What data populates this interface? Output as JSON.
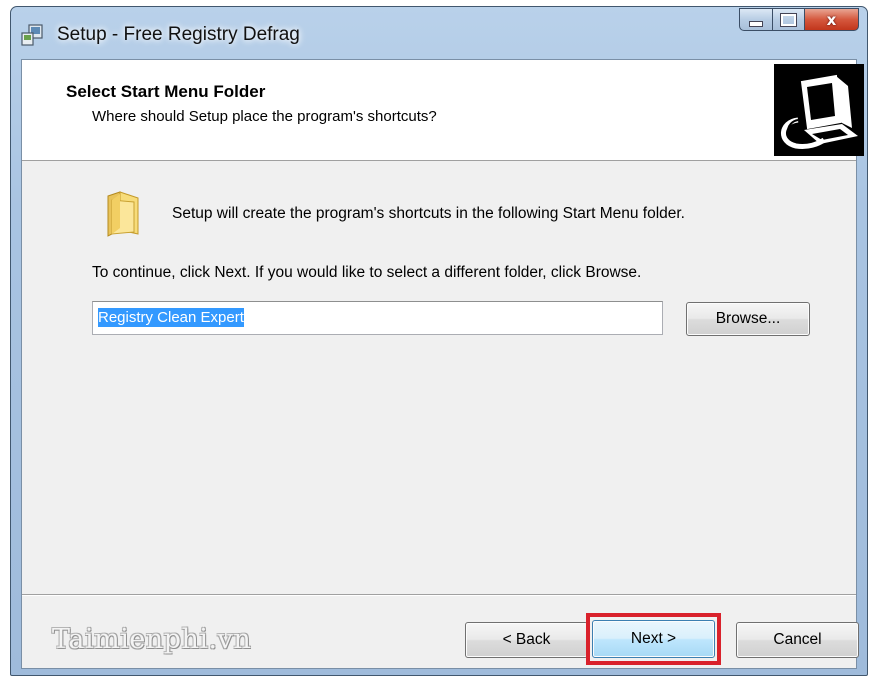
{
  "window": {
    "title": "Setup - Free Registry Defrag",
    "controls": {
      "minimize": "minimize-icon",
      "maximize": "maximize-icon",
      "close": "close-icon",
      "close_glyph": "x"
    }
  },
  "header": {
    "title": "Select Start Menu Folder",
    "subtitle": "Where should Setup place the program's shortcuts?",
    "image": "installer-computer-icon"
  },
  "body": {
    "icon": "folder-icon",
    "intro": "Setup will create the program's shortcuts in the following Start Menu folder.",
    "continue": "To continue, click Next. If you would like to select a different folder, click Browse.",
    "folder_value": "Registry Clean Expert",
    "browse_label": "Browse..."
  },
  "footer": {
    "brand": "Taimienphi.vn",
    "back_label": "< Back",
    "next_label": "Next >",
    "cancel_label": "Cancel",
    "highlight_color": "#d9212b"
  }
}
